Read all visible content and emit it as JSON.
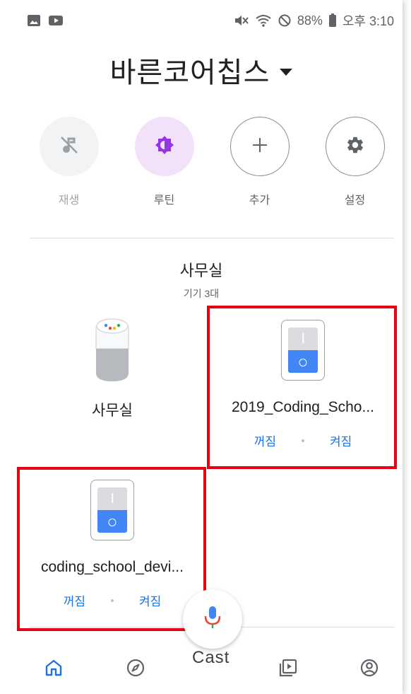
{
  "status_bar": {
    "battery": "88%",
    "time": "오후 3:10"
  },
  "home": {
    "title": "바른코어칩스"
  },
  "quick_actions": [
    {
      "label": "재생",
      "icon": "music-off-icon"
    },
    {
      "label": "루틴",
      "icon": "routine-icon"
    },
    {
      "label": "추가",
      "icon": "plus-icon"
    },
    {
      "label": "설정",
      "icon": "gear-icon"
    }
  ],
  "room": {
    "name": "사무실",
    "device_count": "기기 3대"
  },
  "devices": [
    {
      "name": "사무실",
      "icon": "smart-speaker-icon"
    },
    {
      "name": "2019_Coding_Scho...",
      "icon": "switch-icon",
      "off_label": "꺼짐",
      "on_label": "켜짐"
    },
    {
      "name": "coding_school_devi...",
      "icon": "switch-icon",
      "off_label": "꺼짐",
      "on_label": "켜짐"
    }
  ],
  "bottom": {
    "cast_label": "Cast"
  },
  "colors": {
    "accent": "#1a73e8",
    "highlight": "#e60012",
    "routine_bg": "#f3e1f9",
    "routine_icon": "#9334e6"
  }
}
